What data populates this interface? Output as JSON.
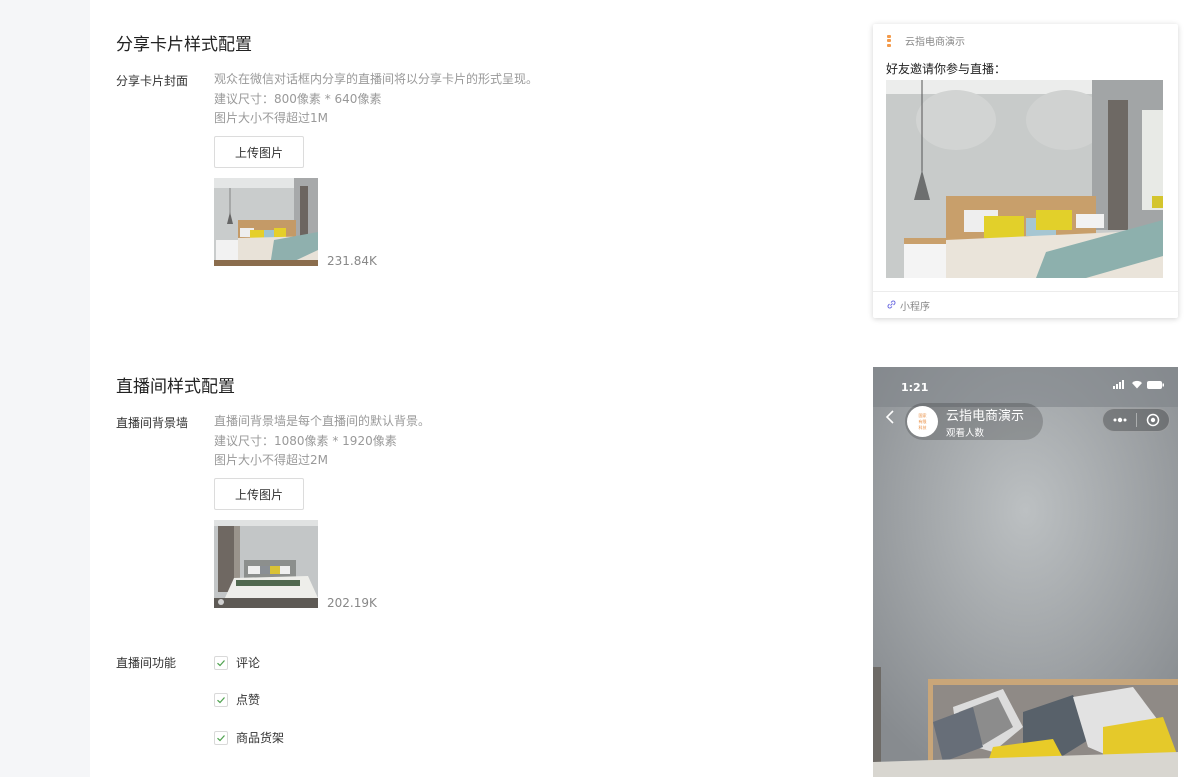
{
  "share_card": {
    "section_title": "分享卡片样式配置",
    "field_label": "分享卡片封面",
    "help_lines": [
      "观众在微信对话框内分享的直播间将以分享卡片的形式呈现。",
      "建议尺寸：800像素 * 640像素",
      "图片大小不得超过1M"
    ],
    "upload_label": "上传图片",
    "file_size": "231.84K"
  },
  "live_room": {
    "section_title": "直播间样式配置",
    "field_label": "直播间背景墙",
    "help_lines": [
      "直播间背景墙是每个直播间的默认背景。",
      "建议尺寸：1080像素 * 1920像素",
      "图片大小不得超过2M"
    ],
    "upload_label": "上传图片",
    "file_size": "202.19K",
    "features_label": "直播间功能",
    "features": [
      {
        "label": "评论",
        "checked": true
      },
      {
        "label": "点赞",
        "checked": true
      },
      {
        "label": "商品货架",
        "checked": true
      }
    ]
  },
  "card_preview": {
    "brand": "云指电商演示",
    "invite": "好友邀请你参与直播：",
    "footer": "小程序"
  },
  "phone_preview": {
    "time": "1:21",
    "room_name": "云指电商演示",
    "room_sub": "观看人数",
    "avatar_lines": [
      "国家",
      "有限",
      "科技"
    ]
  },
  "colors": {
    "accent": "#f39a4a",
    "checkbox_check": "#52a352"
  }
}
